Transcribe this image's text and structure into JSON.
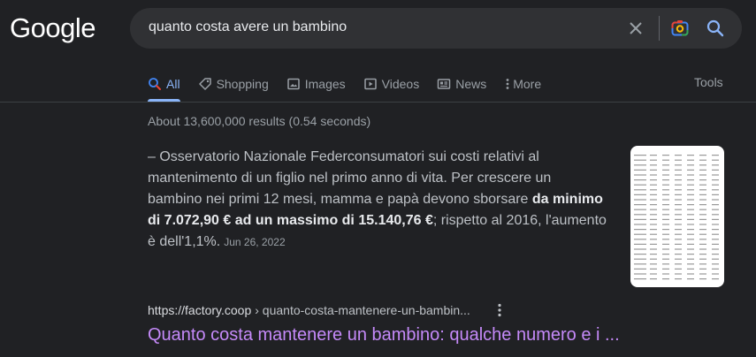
{
  "logo": {
    "text": "Google"
  },
  "search": {
    "query": "quanto costa avere un bambino"
  },
  "tabs": [
    {
      "label": "All",
      "icon": "search-icon",
      "active": true
    },
    {
      "label": "Shopping",
      "icon": "tag-icon"
    },
    {
      "label": "Images",
      "icon": "image-icon"
    },
    {
      "label": "Videos",
      "icon": "play-icon"
    },
    {
      "label": "News",
      "icon": "news-icon"
    },
    {
      "label": "More",
      "icon": "more-vert-icon"
    }
  ],
  "tools_label": "Tools",
  "stats": "About 13,600,000 results (0.54 seconds)",
  "snippet": {
    "text_before": "– Osservatorio Nazionale Federconsumatori sui costi relativi al mantenimento di un figlio nel primo anno di vita. Per crescere un bambino nei primi 12 mesi, mamma e papà devono sborsare ",
    "text_bold": "da minimo di 7.072,90 € ad un massimo di 15.140,76 €",
    "text_after": "; rispetto al 2016, l'aumento è dell'1,1%.",
    "date": "Jun 26, 2022"
  },
  "result": {
    "url_domain": "https://factory.coop",
    "url_path": "› quanto-costa-mantenere-un-bambin...",
    "title": "Quanto costa mantenere un bambino: qualche numero e i ..."
  },
  "colors": {
    "background": "#202124",
    "link_visited": "#c58af9",
    "accent": "#8ab4f8"
  }
}
